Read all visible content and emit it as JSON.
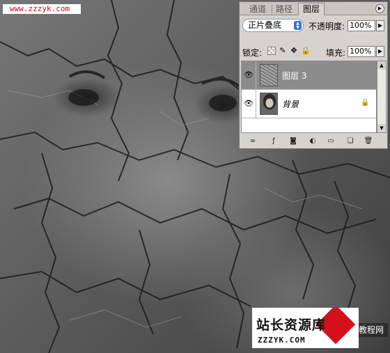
{
  "watermark_top": "www.zzzyk.com",
  "layers_panel": {
    "tabs": [
      "通道",
      "路径",
      "图层"
    ],
    "active_tab": "图层",
    "blend_mode": "正片叠底",
    "opacity_label": "不透明度:",
    "opacity_value": "100%",
    "lock_label": "锁定:",
    "fill_label": "填充:",
    "fill_value": "100%",
    "layers": [
      {
        "name": "图层 3",
        "selected": true,
        "visible": true
      },
      {
        "name": "背景",
        "selected": false,
        "visible": true,
        "locked": true
      }
    ]
  },
  "logo": {
    "title": "站长资源库",
    "url": "ZZZYK.COM",
    "tail": "教程网"
  },
  "colors": {
    "panel_bg": "#d6d3ce",
    "selected_row": "#8c8c8c",
    "blend_arrows": "#3a6fd0",
    "logo_red": "#d4101c",
    "watermark_red": "#d0021b"
  }
}
